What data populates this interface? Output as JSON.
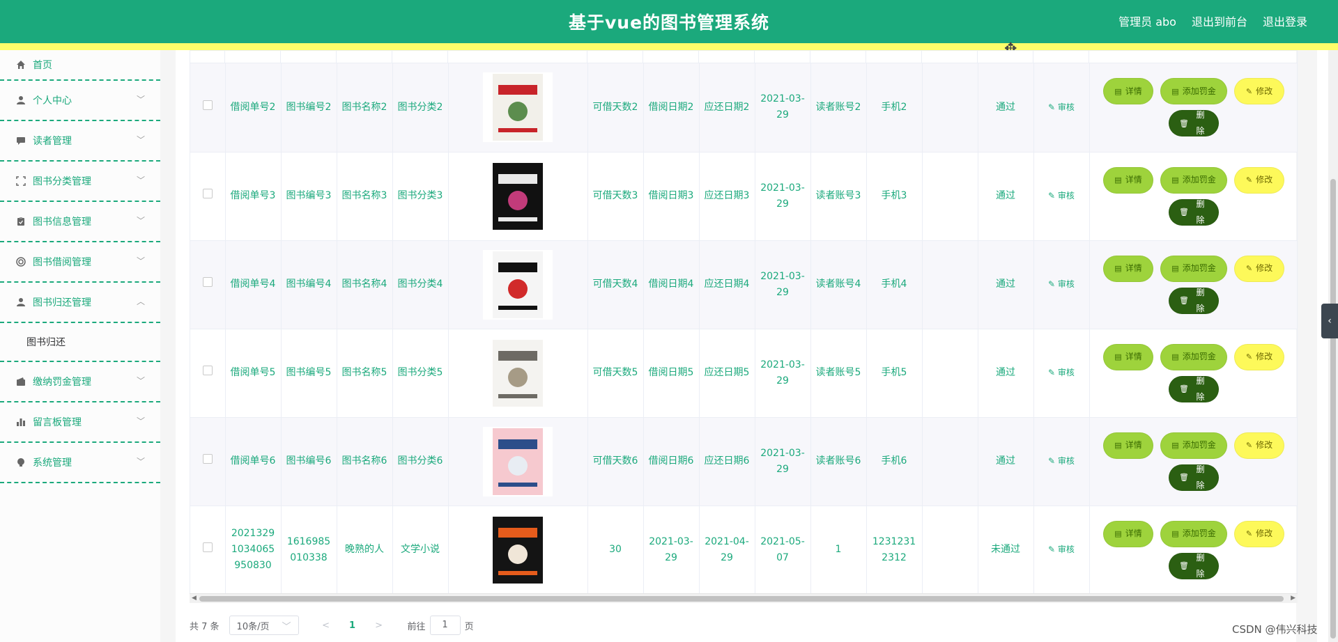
{
  "header": {
    "title": "基于vue的图书管理系统",
    "user": "管理员 abo",
    "to_front": "退出到前台",
    "logout": "退出登录"
  },
  "sidebar": {
    "items": [
      {
        "label": "首页",
        "icon": "home-icon"
      },
      {
        "label": "个人中心",
        "icon": "user-icon"
      },
      {
        "label": "读者管理",
        "icon": "chat-icon"
      },
      {
        "label": "图书分类管理",
        "icon": "fullscreen-icon"
      },
      {
        "label": "图书信息管理",
        "icon": "clipboard-icon"
      },
      {
        "label": "图书借阅管理",
        "icon": "circle-icon"
      },
      {
        "label": "图书归还管理",
        "icon": "user-icon"
      },
      {
        "label": "缴纳罚金管理",
        "icon": "wallet-icon"
      },
      {
        "label": "留言板管理",
        "icon": "bar-chart-icon"
      },
      {
        "label": "系统管理",
        "icon": "bulb-icon"
      }
    ],
    "submenu": {
      "label": "图书归还"
    }
  },
  "table": {
    "rows": [
      {
        "borrow_no": "借阅单号2",
        "book_no": "图书编号2",
        "book_name": "图书名称2",
        "category": "图书分类2",
        "cover_colors": [
          "#f2f0ea",
          "#c8242a",
          "#5c8d4e"
        ],
        "days": "可借天数2",
        "borrow_date": "借阅日期2",
        "due_date": "应还日期2",
        "return_date": "2021-03-29",
        "reader": "读者账号2",
        "phone": "手机2",
        "status": "通过",
        "audit": "审核"
      },
      {
        "borrow_no": "借阅单号3",
        "book_no": "图书编号3",
        "book_name": "图书名称3",
        "category": "图书分类3",
        "cover_colors": [
          "#111111",
          "#e9e9e9",
          "#c23b7a"
        ],
        "days": "可借天数3",
        "borrow_date": "借阅日期3",
        "due_date": "应还日期3",
        "return_date": "2021-03-29",
        "reader": "读者账号3",
        "phone": "手机3",
        "status": "通过",
        "audit": "审核"
      },
      {
        "borrow_no": "借阅单号4",
        "book_no": "图书编号4",
        "book_name": "图书名称4",
        "category": "图书分类4",
        "cover_colors": [
          "#f5f5f5",
          "#111111",
          "#d12a2a"
        ],
        "days": "可借天数4",
        "borrow_date": "借阅日期4",
        "due_date": "应还日期4",
        "return_date": "2021-03-29",
        "reader": "读者账号4",
        "phone": "手机4",
        "status": "通过",
        "audit": "审核"
      },
      {
        "borrow_no": "借阅单号5",
        "book_no": "图书编号5",
        "book_name": "图书名称5",
        "category": "图书分类5",
        "cover_colors": [
          "#f4f3f0",
          "#6d6a64",
          "#a69b86"
        ],
        "days": "可借天数5",
        "borrow_date": "借阅日期5",
        "due_date": "应还日期5",
        "return_date": "2021-03-29",
        "reader": "读者账号5",
        "phone": "手机5",
        "status": "通过",
        "audit": "审核"
      },
      {
        "borrow_no": "借阅单号6",
        "book_no": "图书编号6",
        "book_name": "图书名称6",
        "category": "图书分类6",
        "cover_colors": [
          "#f6c9cf",
          "#2c4e8a",
          "#e8edf3"
        ],
        "days": "可借天数6",
        "borrow_date": "借阅日期6",
        "due_date": "应还日期6",
        "return_date": "2021-03-29",
        "reader": "读者账号6",
        "phone": "手机6",
        "status": "通过",
        "audit": "审核"
      },
      {
        "borrow_no": "20213291034065950830",
        "book_no": "1616985010338",
        "book_name": "晚熟的人",
        "category": "文学小说",
        "cover_colors": [
          "#141414",
          "#e65c1c",
          "#f0e6d8"
        ],
        "days": "30",
        "borrow_date": "2021-03-29",
        "due_date": "2021-04-29",
        "return_date": "2021-05-07",
        "reader": "1",
        "phone": "12312312312",
        "status": "未通过",
        "audit": "审核"
      }
    ],
    "buttons": {
      "detail": "详情",
      "fine": "添加罚金",
      "edit": "修改",
      "delete": "删除"
    }
  },
  "pagination": {
    "total": "共 7 条",
    "page_size": "10条/页",
    "current_page": "1",
    "goto_label": "前往",
    "goto_value": "1",
    "page_suffix": "页"
  },
  "watermark": "CSDN @伟兴科技",
  "colors": {
    "primary": "#1ba97c",
    "strip": "#fffe6a",
    "btn_green": "#9ed33c",
    "btn_yellow": "#fdf95a",
    "btn_dark": "#2b5f12"
  }
}
